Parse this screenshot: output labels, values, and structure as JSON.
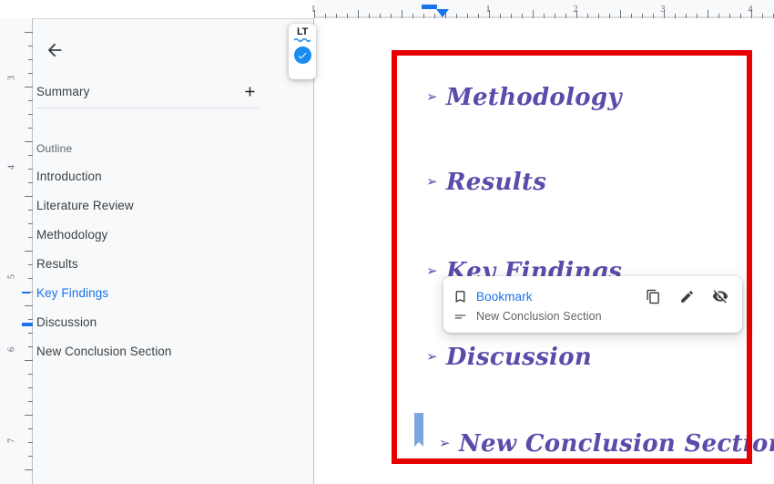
{
  "sidebar": {
    "back_icon": "arrow-left-icon",
    "summary": {
      "label": "Summary",
      "add_icon": "plus-icon"
    },
    "outline_label": "Outline",
    "items": [
      {
        "label": "Introduction",
        "active": false
      },
      {
        "label": "Literature Review",
        "active": false
      },
      {
        "label": "Methodology",
        "active": false
      },
      {
        "label": "Results",
        "active": false
      },
      {
        "label": "Key Findings",
        "active": true
      },
      {
        "label": "Discussion",
        "active": false
      },
      {
        "label": "New Conclusion Section",
        "active": false
      }
    ],
    "active_color": "#1a73e8"
  },
  "language_tool": {
    "logo_text": "LT",
    "status_icon": "check-circle-icon",
    "accent_color": "#1a8cf0"
  },
  "ruler": {
    "horizontal_numbers": [
      "1",
      "1",
      "2",
      "3",
      "4"
    ],
    "vertical_numbers": [
      "3",
      "4",
      "5",
      "6",
      "7"
    ],
    "indent_marker_color": "#1a73e8"
  },
  "document": {
    "selection_outline_color": "#e60000",
    "heading_color": "#5b4bab",
    "bullet_glyph": "➢",
    "headings": [
      {
        "text": "Methodology",
        "linked": false
      },
      {
        "text": "Results",
        "linked": false
      },
      {
        "text": "Key Findings",
        "linked": true
      },
      {
        "text": "Discussion",
        "linked": false
      },
      {
        "text": "New Conclusion Section",
        "linked": false
      }
    ]
  },
  "bookmark_popup": {
    "icon": "bookmark-icon",
    "title": "Bookmark",
    "subtitle_icon": "short-text-icon",
    "subtitle": "New Conclusion Section",
    "actions": [
      {
        "name": "copy-link-icon"
      },
      {
        "name": "edit-icon"
      },
      {
        "name": "remove-bookmark-icon"
      }
    ],
    "link_color": "#1a73e8"
  }
}
